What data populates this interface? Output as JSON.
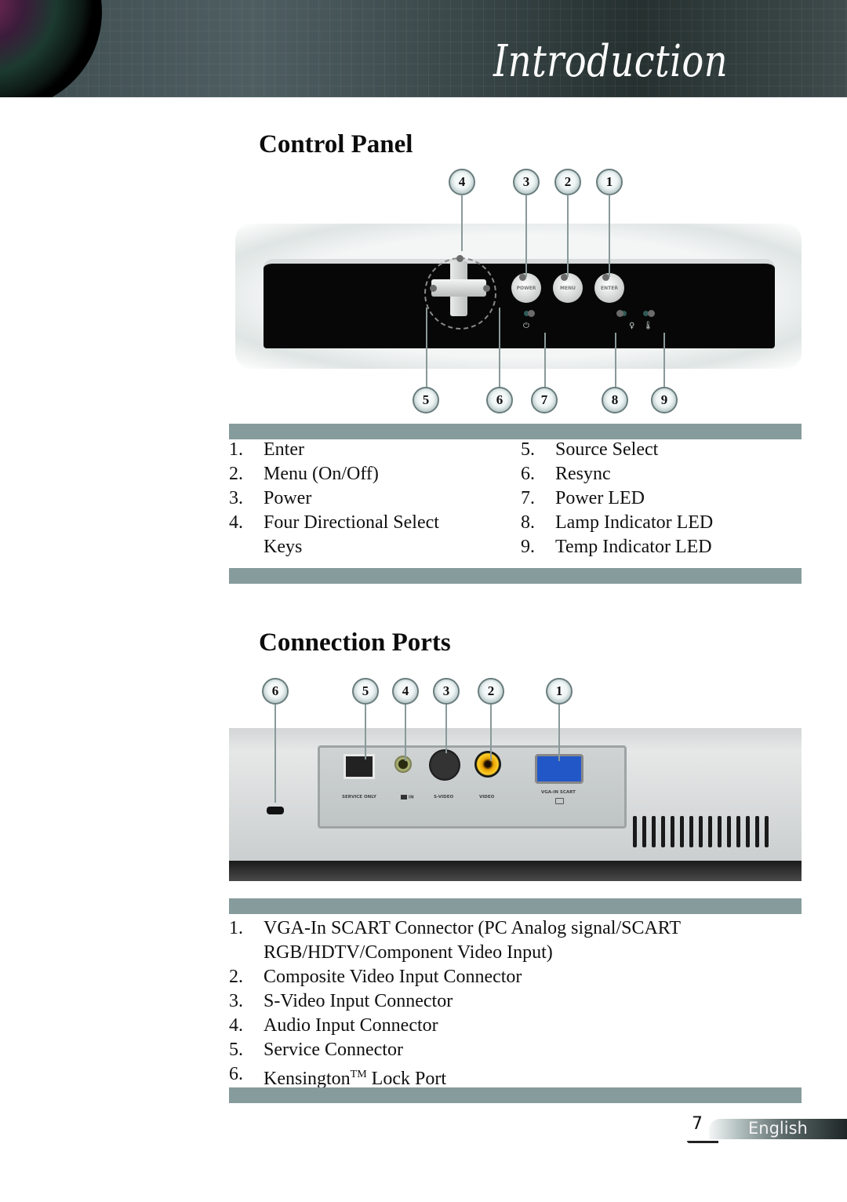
{
  "header": {
    "title": "Introduction"
  },
  "control_panel": {
    "heading": "Control Panel",
    "top_callouts": [
      "4",
      "3",
      "2",
      "1"
    ],
    "bottom_callouts": [
      "5",
      "6",
      "7",
      "8",
      "9"
    ],
    "button_labels": [
      "POWER",
      "MENU",
      "ENTER"
    ],
    "indicator_icons": [
      "power-symbol",
      "lamp-symbol",
      "thermometer-symbol"
    ],
    "items_left": [
      {
        "num": "1.",
        "label": "Enter"
      },
      {
        "num": "2.",
        "label": "Menu (On/Off)"
      },
      {
        "num": "3.",
        "label": "Power"
      },
      {
        "num": "4.",
        "label": "Four Directional Select Keys"
      }
    ],
    "items_right": [
      {
        "num": "5.",
        "label": "Source Select"
      },
      {
        "num": "6.",
        "label": "Resync"
      },
      {
        "num": "7.",
        "label": "Power LED"
      },
      {
        "num": "8.",
        "label": "Lamp Indicator LED"
      },
      {
        "num": "9.",
        "label": "Temp Indicator LED"
      }
    ]
  },
  "connection_ports": {
    "heading": "Connection Ports",
    "callouts": [
      "6",
      "5",
      "4",
      "3",
      "2",
      "1"
    ],
    "port_labels": [
      "SERVICE ONLY",
      "IN",
      "S-VIDEO",
      "VIDEO",
      "VGA-IN SCART"
    ],
    "items": [
      {
        "num": "1.",
        "label": "VGA-In SCART Connector (PC Analog signal/SCART RGB/HDTV/Component Video Input)"
      },
      {
        "num": "2.",
        "label": "Composite Video Input Connector"
      },
      {
        "num": "3.",
        "label": "S-Video Input Connector"
      },
      {
        "num": "4.",
        "label": "Audio Input Connector"
      },
      {
        "num": "5.",
        "label": "Service Connector"
      },
      {
        "num": "6.",
        "label": "Kensington",
        "superscript": "TM",
        "suffix": " Lock Port"
      }
    ]
  },
  "footer": {
    "page_number": "7",
    "language": "English"
  },
  "colors": {
    "section_bar": "#869b9c",
    "header_bg": "#3e4c4f"
  }
}
